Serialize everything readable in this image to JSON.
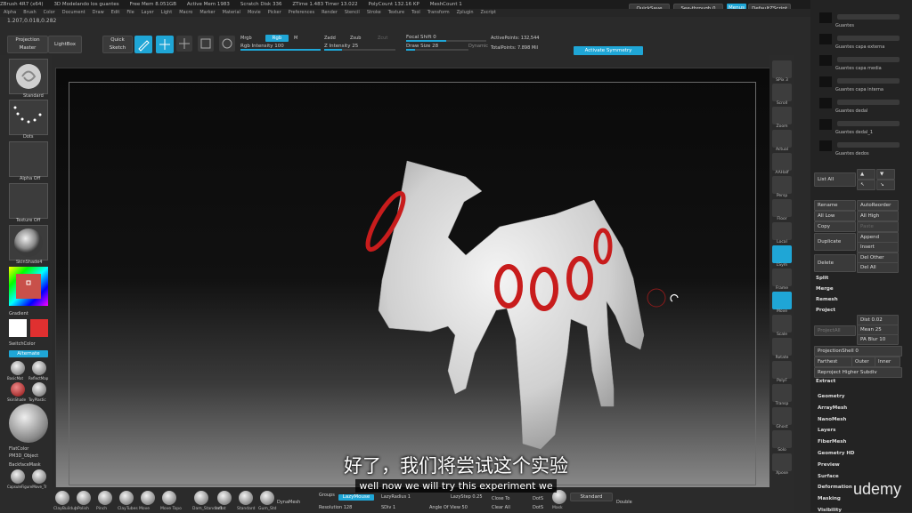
{
  "titlebar": {
    "items": [
      "ZBrush 4R7 (x64)",
      "3D Modelando los guantes",
      "Free Mem 8.051GB",
      "Active Mem 1983",
      "Scratch Disk 336",
      "ZTime 1.483 Timer 13.022",
      "PolyCount 132.16 KP",
      "MeshCount 1"
    ],
    "quicksave": "QuickSave",
    "seethrough": "See-through 0",
    "menus": "Menus",
    "script": "DefaultZScript"
  },
  "menubar": [
    "Alpha",
    "Brush",
    "Color",
    "Document",
    "Draw",
    "Edit",
    "File",
    "Layer",
    "Light",
    "Macro",
    "Marker",
    "Material",
    "Movie",
    "Picker",
    "Preferences",
    "Render",
    "Stencil",
    "Stroke",
    "Texture",
    "Tool",
    "Transform",
    "Zplugin",
    "Zscript"
  ],
  "coords": "1.207,0.018,0.282",
  "toolbar": {
    "projection_master": "Projection Master",
    "lightbox": "LightBox",
    "quick_sketch": "Quick Sketch",
    "edit": "Edit",
    "draw": "Draw",
    "move": "Move",
    "scale": "Scale",
    "rotate": "Rotate",
    "mrgb": "Mrgb",
    "rgb": "Rgb",
    "m": "M",
    "zadd": "Zadd",
    "zsub": "Zsub",
    "zcut": "Zcut",
    "rgb_intensity": "Rgb Intensity 100",
    "z_intensity": "Z Intensity 25",
    "focal_shift": "Focal Shift 0",
    "draw_size": "Draw Size 28",
    "dynamic": "Dynamic",
    "active_points": "ActivePoints: 132,544",
    "total_points": "TotalPoints: 7.898 Mil",
    "activate_symmetry": "Activate Symmetry"
  },
  "leftpanel": {
    "standard": "Standard",
    "dots": "Dots",
    "alpha_off": "Alpha Off",
    "texture_off": "Texture Off",
    "material": "SkinShade4",
    "gradient": "Gradient",
    "switch_color": "SwitchColor",
    "alternate": "Alternate",
    "mats": [
      "BasicMat",
      "ReflectMap",
      "SkinShade",
      "ToyPlastic"
    ],
    "flat": "FlatColor",
    "pm3d": "PM3D_Object",
    "backface": "BackfaceMask",
    "capsule": "CapsuleFigureMove_Tr"
  },
  "rtool": [
    "SPix 3",
    "Scroll",
    "Zoom",
    "Actual",
    "AAHalf",
    "Persp",
    "Floor",
    "Local",
    "LSym",
    "Frame",
    "Move",
    "Scale",
    "Rotate",
    "PolyF",
    "Transp",
    "Ghost",
    "Solo",
    "Xpose"
  ],
  "rpanel": {
    "subtools": [
      "Guantes",
      "Guantes capa externa",
      "Guantes capa media",
      "Guantes capa interna",
      "Guantes dedal",
      "Guantes dedal_1",
      "Guantes dedos"
    ],
    "list_all": "List All",
    "rename": "Rename",
    "autoreorder": "AutoReorder",
    "all_low": "All Low",
    "all_high": "All High",
    "copy": "Copy",
    "paste": "Paste",
    "duplicate": "Duplicate",
    "append": "Append",
    "insert": "Insert",
    "delete": "Delete",
    "del_other": "Del Other",
    "del_all": "Del All",
    "split": "Split",
    "merge": "Merge",
    "remesh": "Remesh",
    "project": "Project",
    "dist": "Dist 0.02",
    "mean": "Mean 25",
    "pa_blur": "PA Blur 10",
    "projectall": "ProjectAll",
    "projection_shell": "ProjectionShell 0",
    "farthest": "Farthest",
    "outer": "Outer",
    "inner": "Inner",
    "reproject": "Reproject Higher Subdiv",
    "extract": "Extract",
    "subpalettes": [
      "Geometry",
      "ArrayMesh",
      "NanoMesh",
      "Layers",
      "FiberMesh",
      "Geometry HD",
      "Preview",
      "Surface",
      "Deformation",
      "Masking",
      "Visibility"
    ]
  },
  "bottombar": {
    "brushes": [
      "ClayBuildup",
      "hPolish",
      "Pinch",
      "ClayTubes",
      "Move",
      "Move Topo",
      "Dam_Standard",
      "Inflat",
      "Standard",
      "Gum_Std"
    ],
    "dynamesh": "DynaMesh",
    "groups": "Groups",
    "resolution": "Resolution 128",
    "project": "Project",
    "lazymouse": "LazyMouse",
    "lazyradius": "LazyRadius 1",
    "lazystep": "LazyStep 0.25",
    "smt": "Smt",
    "sdiv": "SDiv 1",
    "angle_of_view": "Angle Of View 50",
    "close_to": "Close To",
    "clear_all": "Clear All",
    "dots": "DotS",
    "dot_label": "DotS",
    "mask": "Mask",
    "standard": "Standard",
    "double": "Double"
  },
  "subtitle": {
    "zh": "好了，我们将尝试这个实验",
    "en": "well now we will try this experiment we"
  },
  "watermark": "udemy",
  "colors": {
    "accent": "#1fa6d6",
    "gradient_red": "#e03030",
    "ring_red": "#c81c1c"
  }
}
